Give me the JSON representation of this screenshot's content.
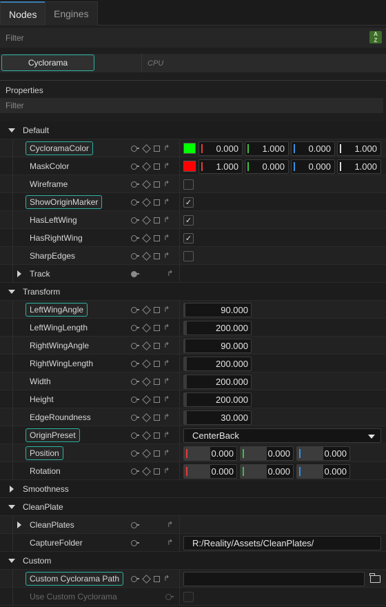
{
  "tabs": [
    {
      "label": "Nodes",
      "active": true
    },
    {
      "label": "Engines",
      "active": false
    }
  ],
  "top_filter": {
    "placeholder": "Filter"
  },
  "node": {
    "name": "Cyclorama",
    "device": "CPU"
  },
  "properties": {
    "title": "Properties",
    "filter_placeholder": "Filter"
  },
  "colors": {
    "accent": "#2fb3a0",
    "red": "#e8393b",
    "green": "#3fbf3f",
    "blue": "#3a8fe0",
    "white": "#dddddd"
  },
  "groups": {
    "default": "Default",
    "track": "Track",
    "transform": "Transform",
    "smoothness": "Smoothness",
    "cleanplate": "CleanPlate",
    "cleanplates": "CleanPlates",
    "custom": "Custom"
  },
  "props": {
    "cyclorama_color": {
      "label": "CycloramaColor",
      "swatch": "#00ff00",
      "values": [
        "0.000",
        "1.000",
        "0.000",
        "1.000"
      ]
    },
    "mask_color": {
      "label": "MaskColor",
      "swatch": "#ff0000",
      "values": [
        "1.000",
        "0.000",
        "0.000",
        "1.000"
      ]
    },
    "wireframe": {
      "label": "Wireframe",
      "checked": false
    },
    "show_origin_marker": {
      "label": "ShowOriginMarker",
      "checked": true
    },
    "has_left_wing": {
      "label": "HasLeftWing",
      "checked": true
    },
    "has_right_wing": {
      "label": "HasRightWing",
      "checked": true
    },
    "sharp_edges": {
      "label": "SharpEdges",
      "checked": false
    },
    "left_wing_angle": {
      "label": "LeftWingAngle",
      "value": "90.000"
    },
    "left_wing_length": {
      "label": "LeftWingLength",
      "value": "200.000"
    },
    "right_wing_angle": {
      "label": "RightWingAngle",
      "value": "90.000"
    },
    "right_wing_length": {
      "label": "RightWingLength",
      "value": "200.000"
    },
    "width": {
      "label": "Width",
      "value": "200.000"
    },
    "height": {
      "label": "Height",
      "value": "200.000"
    },
    "edge_roundness": {
      "label": "EdgeRoundness",
      "value": "30.000"
    },
    "origin_preset": {
      "label": "OriginPreset",
      "value": "CenterBack"
    },
    "position": {
      "label": "Position",
      "values": [
        "0.000",
        "0.000",
        "0.000"
      ]
    },
    "rotation": {
      "label": "Rotation",
      "values": [
        "0.000",
        "0.000",
        "0.000"
      ]
    },
    "capture_folder": {
      "label": "CaptureFolder",
      "value": "R:/Reality/Assets/CleanPlates/"
    },
    "custom_cyclorama_path": {
      "label": "Custom Cyclorama Path",
      "value": ""
    },
    "use_custom_cyclorama": {
      "label": "Use Custom Cyclorama",
      "checked": false
    }
  }
}
